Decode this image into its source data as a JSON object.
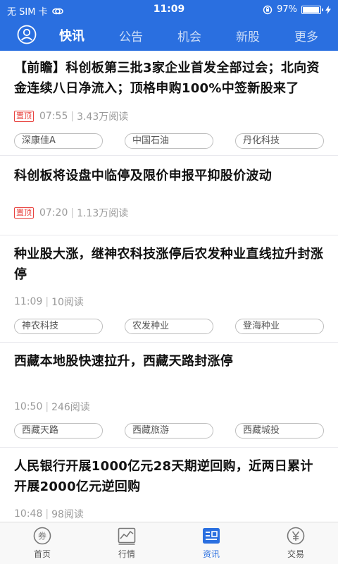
{
  "status_bar": {
    "carrier": "无 SIM 卡",
    "time": "11:09",
    "battery": "97%",
    "battery_level": 0.97
  },
  "nav": {
    "tabs": [
      {
        "label": "快讯",
        "active": true
      },
      {
        "label": "公告"
      },
      {
        "label": "机会"
      },
      {
        "label": "新股"
      },
      {
        "label": "更多"
      }
    ]
  },
  "feed": [
    {
      "title": "【前瞻】科创板第三批3家企业首发全部过会；北向资金连续八日净流入；顶格申购100%中签新股来了",
      "pinned": "置顶",
      "time": "07:55",
      "reads": "3.43万阅读",
      "tags": [
        "深康佳A",
        "中国石油",
        "丹化科技"
      ]
    },
    {
      "title": "科创板将设盘中临停及限价申报平抑股价波动",
      "pinned": "置顶",
      "time": "07:20",
      "reads": "1.13万阅读",
      "tags": []
    },
    {
      "title": "种业股大涨，继神农科技涨停后农发种业直线拉升封涨停",
      "time": "11:09",
      "reads": "10阅读",
      "tags": [
        "神农科技",
        "农发种业",
        "登海种业"
      ]
    },
    {
      "title": "西藏本地股快速拉升，西藏天路封涨停",
      "time": "10:50",
      "reads": "246阅读",
      "tags": [
        "西藏天路",
        "西藏旅游",
        "西藏城投"
      ]
    },
    {
      "title": "人民银行开展1000亿元28天期逆回购，近两日累计开展2000亿元逆回购",
      "time": "10:48",
      "reads": "98阅读",
      "tags": []
    }
  ],
  "tabbar": [
    {
      "label": "首页",
      "icon": "coupon-icon"
    },
    {
      "label": "行情",
      "icon": "chart-icon"
    },
    {
      "label": "资讯",
      "icon": "news-icon",
      "active": true
    },
    {
      "label": "交易",
      "icon": "yen-icon"
    }
  ],
  "colors": {
    "brand": "#2a6fe0",
    "pinned": "#e8423e"
  }
}
